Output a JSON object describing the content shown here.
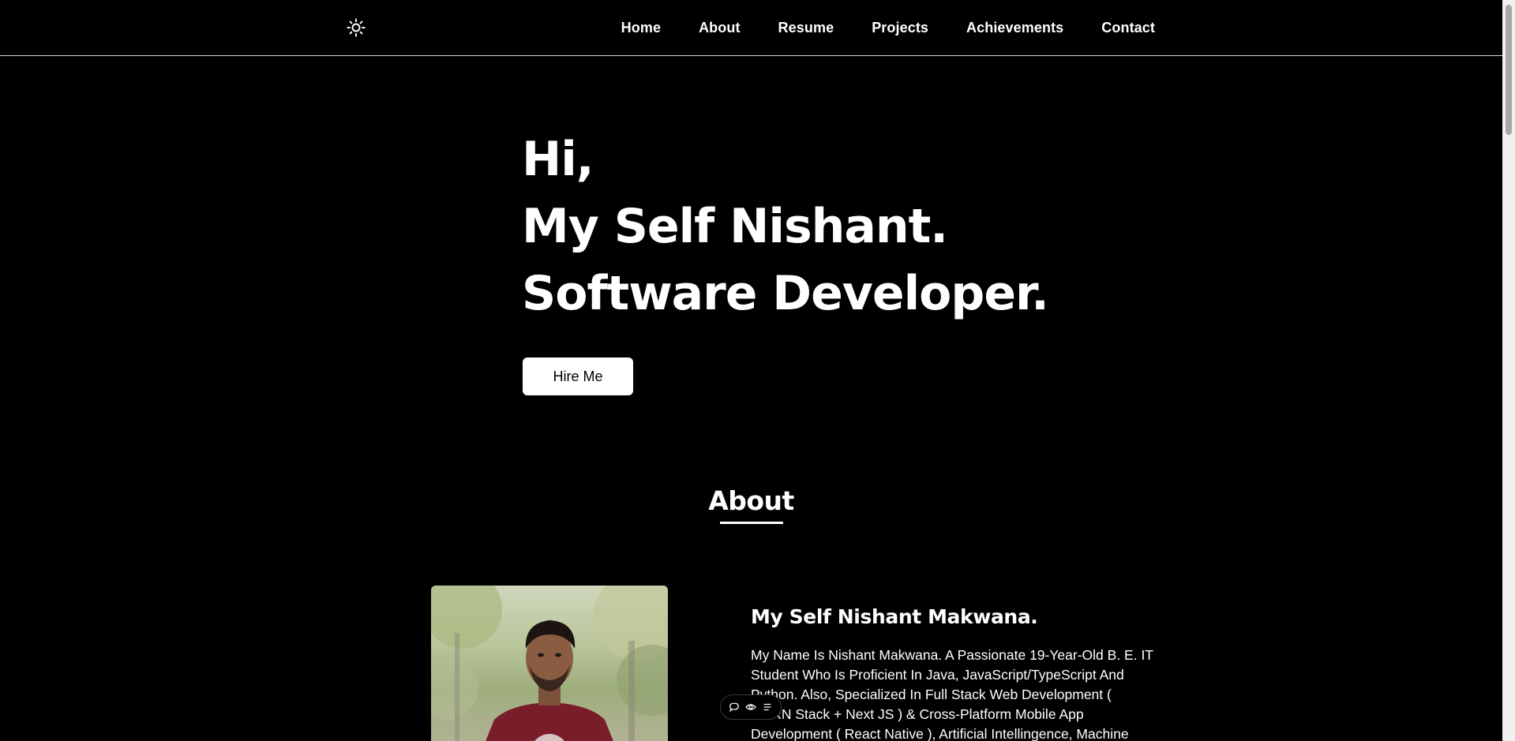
{
  "navbar": {
    "theme_icon": "sun-icon",
    "links": [
      "Home",
      "About",
      "Resume",
      "Projects",
      "Achievements",
      "Contact"
    ]
  },
  "hero": {
    "line1": "Hi,",
    "line2": "My Self Nishant.",
    "line3": "Software Developer.",
    "cta_label": "Hire Me"
  },
  "about": {
    "title": "About",
    "name_heading": "My Self Nishant Makwana.",
    "body": "My Name Is Nishant Makwana. A Passionate 19-Year-Old B. E. IT Student Who Is Proficient In Java, JavaScript/TypeScript And Python. Also, Specialized In Full Stack Web Development ( MERN Stack + Next JS ) & Cross-Platform Mobile App Development ( React Native ), Artificial Intellingence, Machine Learning & Data"
  },
  "mini_toolbar": {
    "icons": [
      "comment-icon",
      "eye-icon",
      "menu-icon"
    ]
  },
  "colors": {
    "background": "#000000",
    "text": "#ffffff",
    "button_bg": "#ffffff",
    "button_text": "#000000"
  }
}
